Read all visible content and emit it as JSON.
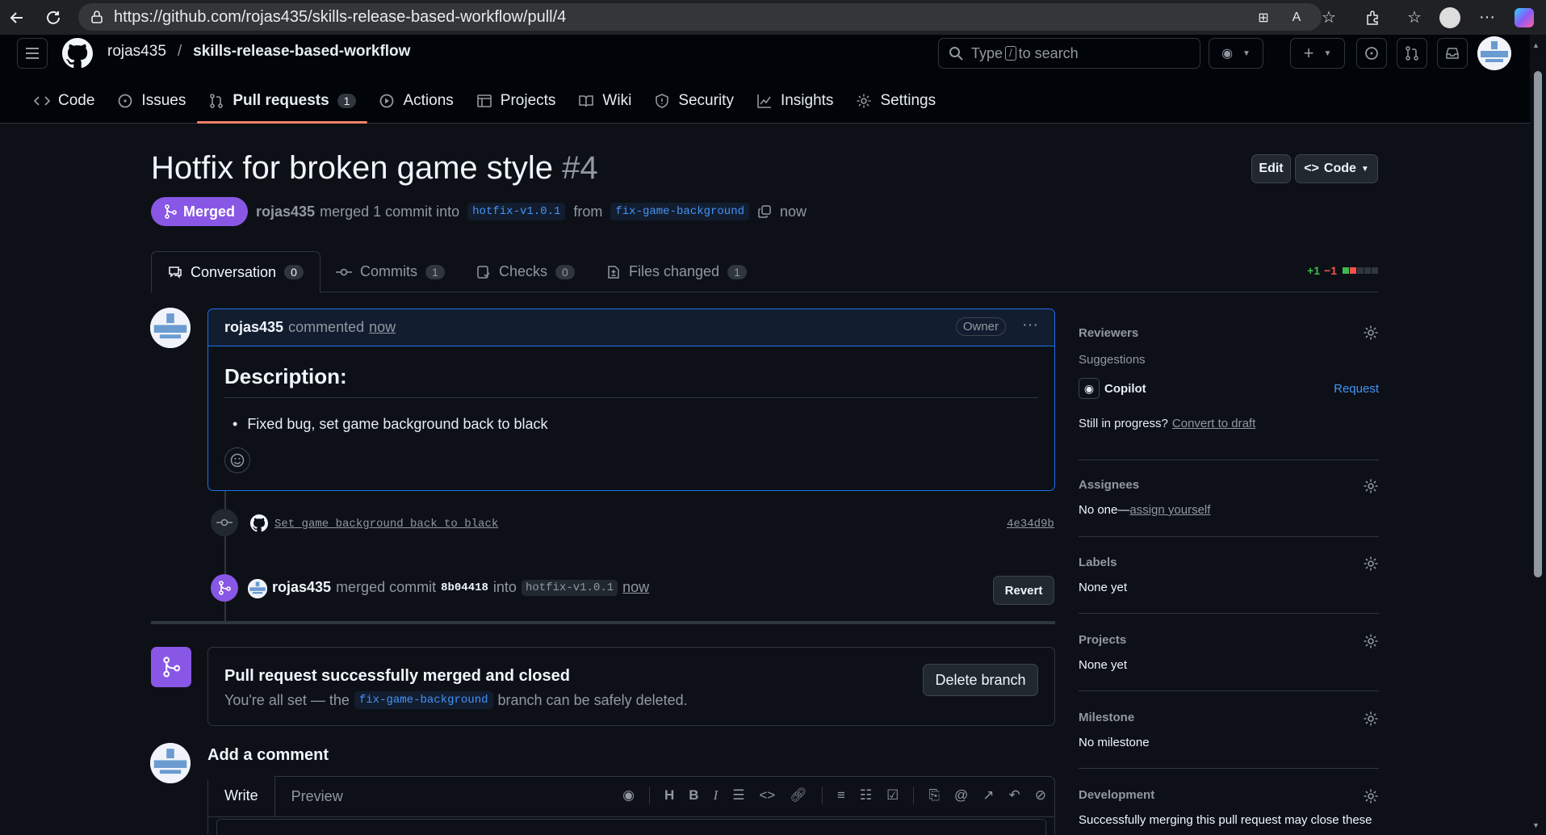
{
  "browser": {
    "url": "https://github.com/rojas435/skills-release-based-workflow/pull/4"
  },
  "header": {
    "owner": "rojas435",
    "separator": "/",
    "repo": "skills-release-based-workflow",
    "search_pre": "Type",
    "search_key": "/",
    "search_post": "to search"
  },
  "repo_tabs": [
    {
      "label": "Code",
      "icon": "code-icon"
    },
    {
      "label": "Issues",
      "icon": "issue-icon"
    },
    {
      "label": "Pull requests",
      "icon": "pull-request-icon",
      "count": "1"
    },
    {
      "label": "Actions",
      "icon": "play-icon"
    },
    {
      "label": "Projects",
      "icon": "table-icon"
    },
    {
      "label": "Wiki",
      "icon": "book-icon"
    },
    {
      "label": "Security",
      "icon": "shield-icon"
    },
    {
      "label": "Insights",
      "icon": "graph-icon"
    },
    {
      "label": "Settings",
      "icon": "gear-icon"
    }
  ],
  "pr": {
    "title": "Hotfix for broken game style",
    "number": "#4",
    "edit_label": "Edit",
    "code_label": "Code",
    "state": "Merged",
    "author": "rojas435",
    "merge_text": "merged 1 commit into",
    "base": "hotfix-v1.0.1",
    "from": "from",
    "head": "fix-game-background",
    "time": "now"
  },
  "pr_tabs": [
    {
      "label": "Conversation",
      "count": "0"
    },
    {
      "label": "Commits",
      "count": "1"
    },
    {
      "label": "Checks",
      "count": "0"
    },
    {
      "label": "Files changed",
      "count": "1"
    }
  ],
  "diffstat": {
    "add": "+1",
    "del": "−1"
  },
  "comment": {
    "author": "rojas435",
    "action": "commented",
    "time": "now",
    "badge": "Owner",
    "heading": "Description:",
    "bullet": "Fixed bug, set game background back to black"
  },
  "commit": {
    "message": "Set game background back to black",
    "sha": "4e34d9b"
  },
  "merge_event": {
    "author": "rojas435",
    "text": "merged commit",
    "sha": "8b04418",
    "into": "into",
    "branch": "hotfix-v1.0.1",
    "time": "now",
    "revert": "Revert"
  },
  "merged_box": {
    "title": "Pull request successfully merged and closed",
    "pre": "You're all set — the",
    "branch": "fix-game-background",
    "post": "branch can be safely deleted.",
    "button": "Delete branch"
  },
  "add_comment": {
    "title": "Add a comment",
    "write": "Write",
    "preview": "Preview"
  },
  "sidebar": {
    "reviewers": {
      "title": "Reviewers",
      "suggestions": "Suggestions",
      "copilot": "Copilot",
      "request": "Request",
      "progress": "Still in progress?",
      "draft": "Convert to draft"
    },
    "assignees": {
      "title": "Assignees",
      "none": "No one—",
      "assign": "assign yourself"
    },
    "labels": {
      "title": "Labels",
      "value": "None yet"
    },
    "projects": {
      "title": "Projects",
      "value": "None yet"
    },
    "milestone": {
      "title": "Milestone",
      "value": "No milestone"
    },
    "development": {
      "title": "Development",
      "value": "Successfully merging this pull request may close these"
    }
  },
  "colors": {
    "merged": "#8957e5",
    "accent": "#4493f8",
    "tab_underline": "#f78166",
    "bg": "#0d1117"
  }
}
